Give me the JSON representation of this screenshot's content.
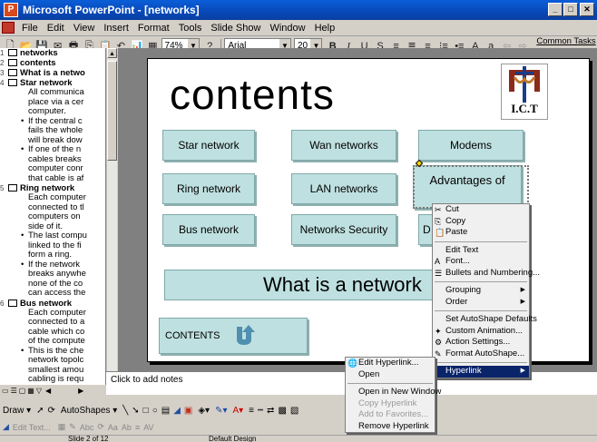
{
  "window": {
    "title": "Microsoft PowerPoint - [networks]"
  },
  "menubar": [
    "File",
    "Edit",
    "View",
    "Insert",
    "Format",
    "Tools",
    "Slide Show",
    "Window",
    "Help"
  ],
  "toolbar": {
    "zoom": "74%",
    "font": "Arial",
    "font_size": "20",
    "common_tasks": "Common Tasks ▾"
  },
  "outline": {
    "slides": [
      {
        "num": "1",
        "title": "networks",
        "bullets": []
      },
      {
        "num": "2",
        "title": "contents",
        "bullets": []
      },
      {
        "num": "3",
        "title": "What is a netwo",
        "bullets": []
      },
      {
        "num": "4",
        "title": "Star network",
        "bullets": [
          "All communica",
          "place via a cer",
          "computer.",
          "If the central c",
          "fails the whole",
          "will break dow",
          "If one of the n",
          "cables breaks",
          "computer conr",
          "that cable is af"
        ]
      },
      {
        "num": "5",
        "title": "Ring network",
        "bullets": [
          "Each computer",
          "connected to tl",
          "computers on",
          "side of it.",
          "The last compu",
          "linked to the fi",
          "form a ring.",
          "If the network",
          "breaks anywhe",
          "none of the co",
          "can access the"
        ]
      },
      {
        "num": "6",
        "title": "Bus network",
        "bullets": [
          "Each computer",
          "connected to a",
          "cable which co",
          "of the compute",
          "This is the che",
          "network topolc",
          "smallest amou",
          "cabling is requ"
        ]
      }
    ]
  },
  "slide": {
    "heading": "contents",
    "logo_text": "I.C.T",
    "buttons": [
      "Star network",
      "Wan networks",
      "Modems",
      "Ring network",
      "LAN networks",
      "Advantages of",
      "Bus network",
      "Networks Security",
      "D"
    ],
    "what_is": "What is a network",
    "contents_button": "CONTENTS"
  },
  "notes_placeholder": "Click to add notes",
  "context_menu": [
    {
      "label": "Cut",
      "icon": "✂",
      "type": "item"
    },
    {
      "label": "Copy",
      "icon": "⎘",
      "type": "item"
    },
    {
      "label": "Paste",
      "icon": "📋",
      "type": "item"
    },
    {
      "type": "sep"
    },
    {
      "label": "Edit Text",
      "type": "item"
    },
    {
      "label": "Font...",
      "icon": "A",
      "type": "item"
    },
    {
      "label": "Bullets and Numbering...",
      "icon": "☰",
      "type": "item"
    },
    {
      "type": "sep"
    },
    {
      "label": "Grouping",
      "type": "item",
      "sub": true
    },
    {
      "label": "Order",
      "type": "item",
      "sub": true
    },
    {
      "type": "sep"
    },
    {
      "label": "Set AutoShape Defaults",
      "type": "item"
    },
    {
      "label": "Custom Animation...",
      "icon": "✦",
      "type": "item"
    },
    {
      "label": "Action Settings...",
      "icon": "⚙",
      "type": "item"
    },
    {
      "label": "Format AutoShape...",
      "icon": "✎",
      "type": "item"
    },
    {
      "type": "sep"
    },
    {
      "label": "Hyperlink",
      "type": "item",
      "sub": true,
      "highlight": true
    }
  ],
  "submenu": [
    {
      "label": "Edit Hyperlink...",
      "icon": "🌐",
      "type": "item"
    },
    {
      "label": "Open",
      "type": "item"
    },
    {
      "type": "sep"
    },
    {
      "label": "Open in New Window",
      "type": "item"
    },
    {
      "label": "Copy Hyperlink",
      "type": "item",
      "disabled": true
    },
    {
      "label": "Add to Favorites...",
      "type": "item",
      "disabled": true
    },
    {
      "label": "Remove Hyperlink",
      "type": "item"
    }
  ],
  "drawbar": {
    "draw": "Draw ▾",
    "autoshapes": "AutoShapes ▾"
  },
  "wordart": {
    "edit_text": "Edit Text..."
  },
  "status": {
    "slide": "Slide 2 of 12",
    "design": "Default Design"
  },
  "colors": {
    "title_bar": "#0a4fc8",
    "slide_button": "#bfe0e0",
    "menu_highlight": "#0a246a",
    "contents_arrow": "#4f8fb0"
  }
}
